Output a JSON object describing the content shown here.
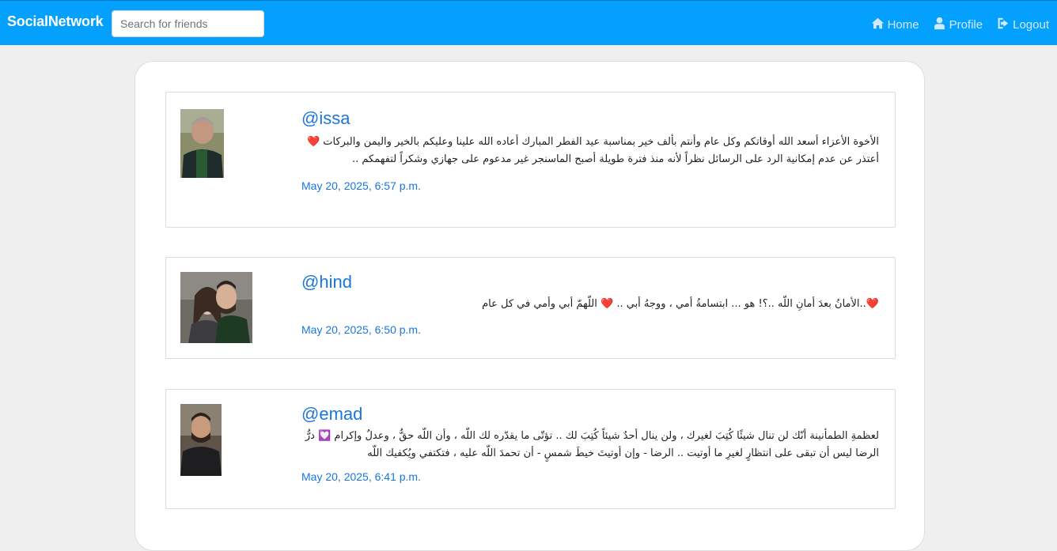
{
  "navbar": {
    "brand": "SocialNetwork",
    "search_placeholder": "Search for friends",
    "links": {
      "home": "Home",
      "profile": "Profile",
      "logout": "Logout"
    }
  },
  "colors": {
    "navbar": "#03a0fd",
    "link": "#1a77d9",
    "heart": "#e0142f"
  },
  "posts": [
    {
      "username": "@issa",
      "text": "الأخوة الأعزاء أسعد الله أوقاتكم وكل عام وأنتم بألف خير بمناسبة عيد الفطر المبارك أعاده الله علينا وعليكم بالخير واليمن والبركات ❤️ أعتذر عن عدم إمكانية الرد على الرسائل نظراً لأنه منذ فترة طويلة أصبح الماسنجر غير مدعوم على جهازي وشكراً لتفهمكم ..",
      "time": "May 20, 2025, 6:57 p.m."
    },
    {
      "username": "@hind",
      "text": "❤️..الأمانُ بعدَ أمانِ اللّه ..؟! هو ... ابتسامةُ أمي ، ووجهُ أبي .. ❤️ اللّهمّ أبي وأمي في كل عام",
      "time": "May 20, 2025, 6:50 p.m."
    },
    {
      "username": "@emad",
      "text": "لعظمةِ الطمأنينة أنّك لن تنال شيئًا كُتِبَ لغيرك ، ولن ينال أحدٌ شيئاً كُتِبَ لك .. تؤتّى ما يقدّره لك اللّه ، وأن اللّه حقٌّ ، وعدلٌ وإكرام 💟 درُّ الرضا ليس أن تبقى على انتظارٍ لغيرِ ما أوتيت .. الرضا - وإن أوتيتَ خيطَ شمسٍ - أن تحمدَ اللّه عليه ، فتكتفي ويُكفيك اللّه",
      "time": "May 20, 2025, 6:41 p.m."
    }
  ]
}
